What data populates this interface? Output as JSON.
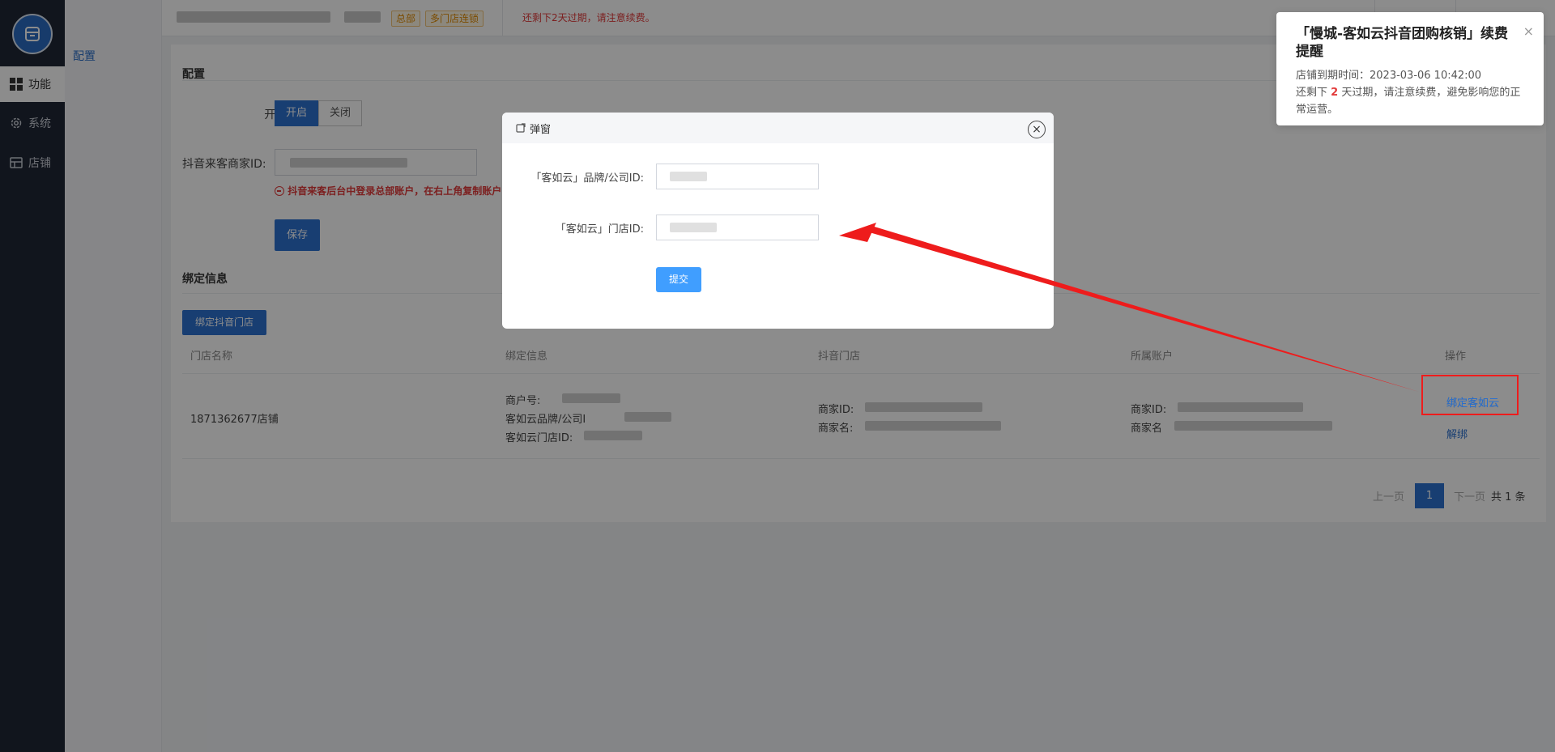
{
  "nav": {
    "items": [
      {
        "label": "功能",
        "icon": "grid-icon"
      },
      {
        "label": "系统",
        "icon": "gear-icon"
      },
      {
        "label": "店铺",
        "icon": "shop-icon"
      }
    ],
    "sub_item": "配置"
  },
  "topbar": {
    "tag_hq": "总部",
    "tag_multi": "多门店连锁",
    "warning": "还剩下2天过期，请注意续费。"
  },
  "config": {
    "title": "配置",
    "switch_label": "开关:",
    "on_label": "开启",
    "off_label": "关闭",
    "merchant_label": "抖音来客商家ID:",
    "hint": "抖音来客后台中登录总部账户，在右上角复制账户",
    "save_label": "保存"
  },
  "binding": {
    "title": "绑定信息",
    "bind_button": "绑定抖音门店",
    "columns": [
      "门店名称",
      "绑定信息",
      "抖音门店",
      "所属账户",
      "操作"
    ],
    "row": {
      "store_name": "1871362677店铺",
      "info_merchant_no": "商户号:",
      "info_brand_id": "客如云品牌/公司I",
      "info_store_id": "客如云门店ID:",
      "douyin_merchant_id": "商家ID:",
      "douyin_merchant_name": "商家名:",
      "account_merchant_id": "商家ID:",
      "account_merchant_name": "商家名",
      "action_bind": "绑定客如云",
      "action_unbind": "解绑"
    },
    "pagination": {
      "prev": "上一页",
      "current": "1",
      "next": "下一页",
      "total": "共 1 条"
    }
  },
  "notification": {
    "title": "「慢城-客如云抖音团购核销」续费提醒",
    "expire_line": "店铺到期时间：2023-03-06 10:42:00",
    "remain_prefix": "还剩下 ",
    "remain_days": "2",
    "remain_suffix": " 天过期，请注意续费，避免影响您的正常运营。",
    "close": "×"
  },
  "modal": {
    "title": "弹窗",
    "brand_label": "「客如云」品牌/公司ID:",
    "store_label": "「客如云」门店ID:",
    "submit": "提交",
    "close": "×"
  },
  "colors": {
    "primary": "#2d72cf",
    "danger": "#e23b3b",
    "nav_bg": "#1f2735",
    "annotation": "#ee1c1c"
  }
}
